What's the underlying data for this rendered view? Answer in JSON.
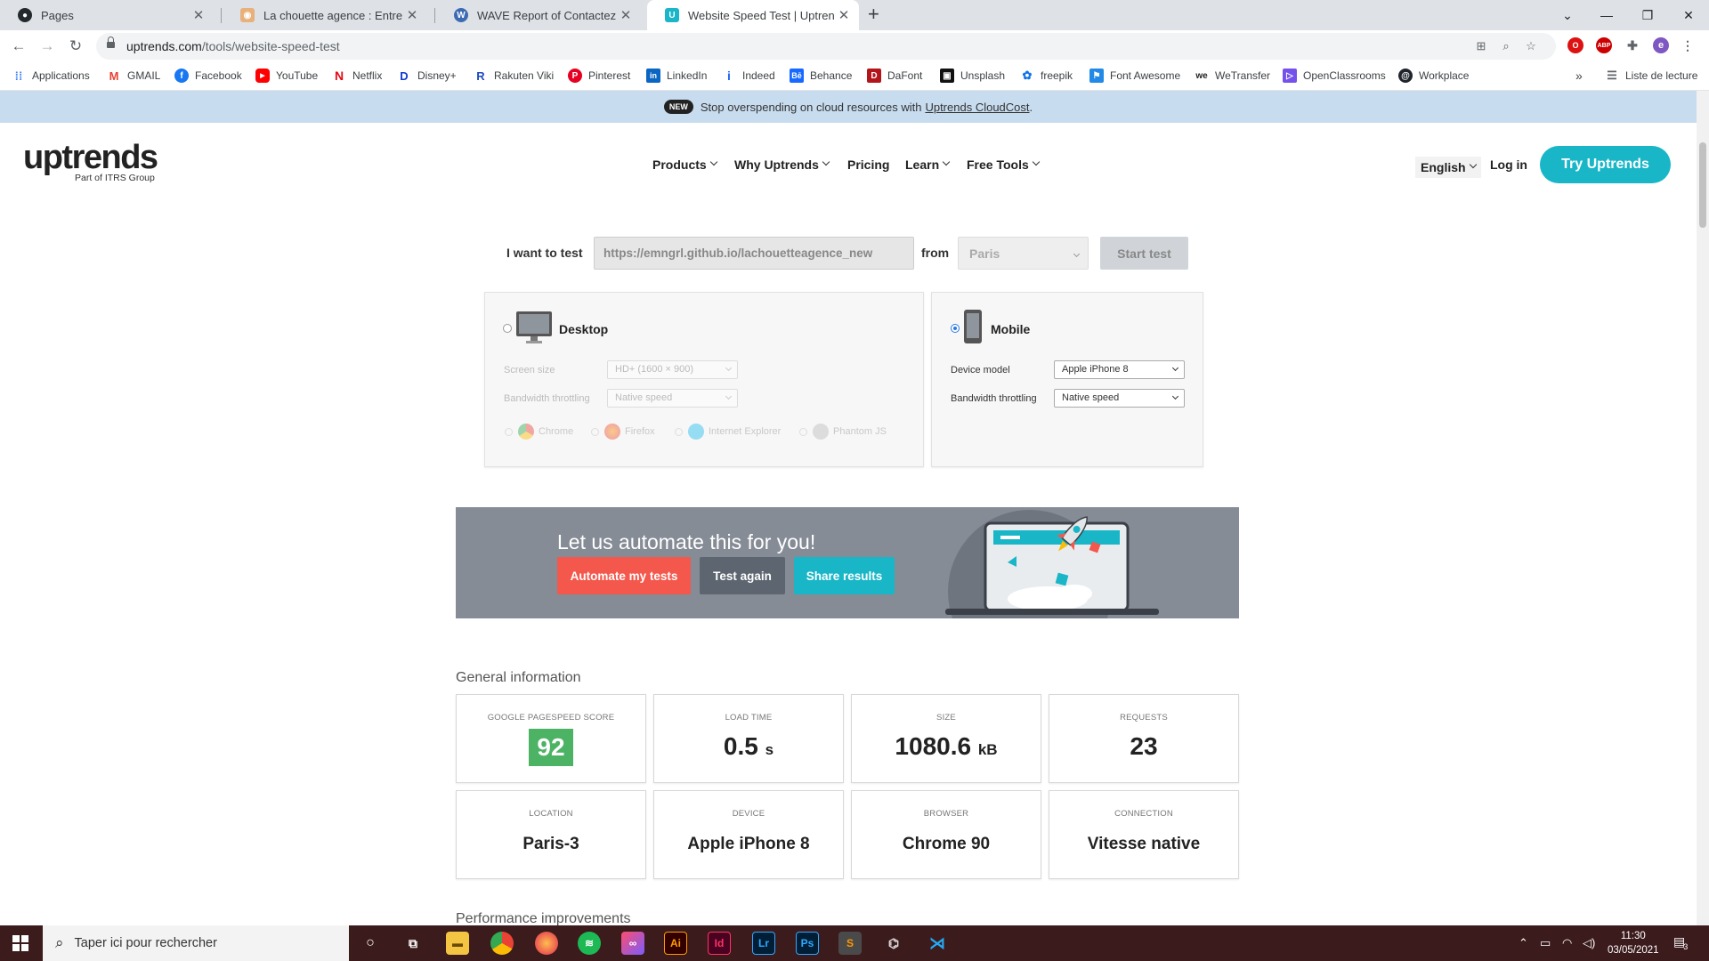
{
  "browser": {
    "tabs": [
      {
        "title": "Pages",
        "active": false
      },
      {
        "title": "La chouette agence : Entreprise w",
        "active": false
      },
      {
        "title": "WAVE Report of Contactez-nous",
        "active": false
      },
      {
        "title": "Website Speed Test | Uptrends",
        "active": true
      }
    ],
    "url_domain": "uptrends.com",
    "url_path": "/tools/website-speed-test",
    "profile_initial": "e",
    "bookmarks": [
      "Applications",
      "GMAIL",
      "Facebook",
      "YouTube",
      "Netflix",
      "Disney+",
      "Rakuten Viki",
      "Pinterest",
      "LinkedIn",
      "Indeed",
      "Behance",
      "DaFont",
      "Unsplash",
      "freepik",
      "Font Awesome",
      "WeTransfer",
      "OpenClassrooms",
      "Workplace"
    ],
    "reading_list": "Liste de lecture",
    "overflow": "»"
  },
  "banner": {
    "badge": "NEW",
    "text": "Stop overspending on cloud resources with",
    "link": "Uptrends CloudCost",
    "period": "."
  },
  "header": {
    "logo": "uptrends",
    "logo_sub": "Part of ITRS Group",
    "nav": [
      "Products",
      "Why Uptrends",
      "Pricing",
      "Learn",
      "Free Tools"
    ],
    "language": "English",
    "login": "Log in",
    "cta": "Try Uptrends"
  },
  "test_form": {
    "label_test": "I want to test",
    "url_value": "https://emngrl.github.io/lachouetteagence_new",
    "label_from": "from",
    "location": "Paris",
    "start_button": "Start test"
  },
  "desktop": {
    "title": "Desktop",
    "selected": false,
    "screen_size_label": "Screen size",
    "screen_size_value": "HD+ (1600 × 900)",
    "bandwidth_label": "Bandwidth throttling",
    "bandwidth_value": "Native speed",
    "browsers": [
      "Chrome",
      "Firefox",
      "Internet Explorer",
      "Phantom JS"
    ]
  },
  "mobile": {
    "title": "Mobile",
    "selected": true,
    "device_label": "Device model",
    "device_value": "Apple iPhone 8",
    "bandwidth_label": "Bandwidth throttling",
    "bandwidth_value": "Native speed"
  },
  "automate": {
    "heading": "Let us automate this for you!",
    "btn_automate": "Automate my tests",
    "btn_again": "Test again",
    "btn_share": "Share results"
  },
  "general": {
    "title": "General information",
    "cards": [
      {
        "label": "GOOGLE PAGESPEED SCORE",
        "value": "92",
        "unit": ""
      },
      {
        "label": "LOAD TIME",
        "value": "0.5",
        "unit": "s"
      },
      {
        "label": "SIZE",
        "value": "1080.6",
        "unit": "kB"
      },
      {
        "label": "REQUESTS",
        "value": "23",
        "unit": ""
      },
      {
        "label": "LOCATION",
        "value": "Paris-3",
        "unit": ""
      },
      {
        "label": "DEVICE",
        "value": "Apple iPhone 8",
        "unit": ""
      },
      {
        "label": "BROWSER",
        "value": "Chrome 90",
        "unit": ""
      },
      {
        "label": "CONNECTION",
        "value": "Vitesse native",
        "unit": ""
      }
    ]
  },
  "performance_title": "Performance improvements",
  "taskbar": {
    "search_placeholder": "Taper ici pour rechercher",
    "time": "11:30",
    "date": "03/05/2021",
    "notif_count": "3"
  },
  "colors": {
    "accent": "#19b6c8",
    "score_green": "#4cb364",
    "automate_red": "#f4574b",
    "test_again_gray": "#5d6670",
    "banner_bg": "#c8dcef",
    "taskbar_bg": "#3b1b1c"
  }
}
